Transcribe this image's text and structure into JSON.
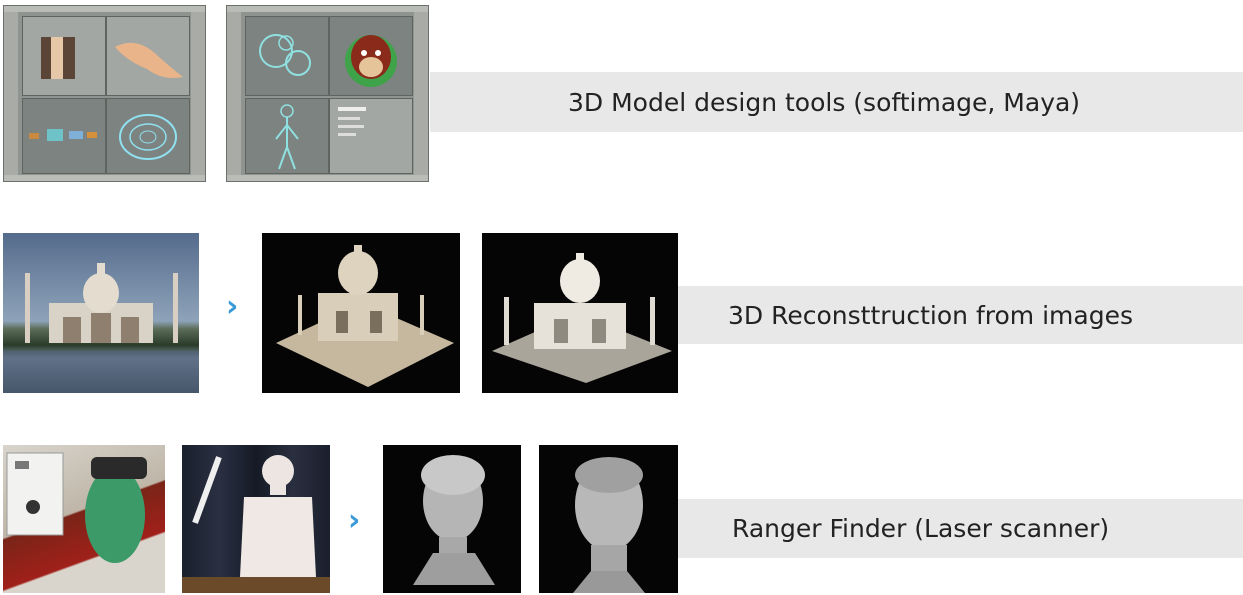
{
  "rows": [
    {
      "label": "3D Model design tools (softimage, Maya)",
      "images": [
        "softimage-screenshot",
        "maya-screenshot"
      ]
    },
    {
      "label": "3D Reconsttruction from images",
      "images": [
        "taj-mahal-photo",
        "taj-mahal-flat-model",
        "taj-mahal-shaded-model"
      ]
    },
    {
      "label": "Ranger Finder (Laser scanner)",
      "images": [
        "laser-scanner-device",
        "handheld-scanner-torso",
        "scanned-female-bust",
        "scanned-male-head"
      ]
    }
  ],
  "colors": {
    "label_bar": "#e8e8e8",
    "arrow": "#3a9ad9",
    "text": "#222222"
  },
  "icons": {
    "arrow": "›"
  }
}
